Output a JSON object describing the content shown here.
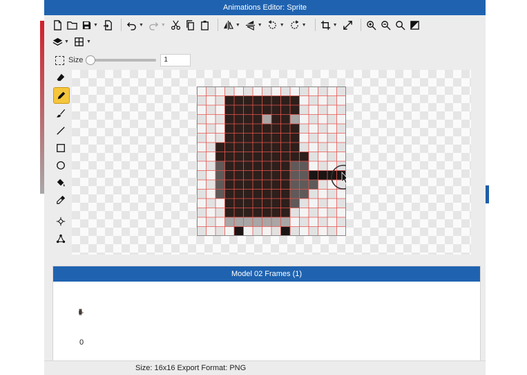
{
  "window": {
    "title": "Animations Editor: Sprite"
  },
  "toolbar": {
    "row1": [
      "new-file-icon",
      "open-folder-icon",
      "save-icon",
      "export-icon",
      "undo-icon",
      "redo-icon",
      "cut-icon",
      "copy-icon",
      "paste-icon",
      "flip-horizontal-icon",
      "flip-vertical-icon",
      "rotate-left-icon",
      "rotate-right-icon",
      "crop-icon",
      "resize-icon",
      "zoom-in-icon",
      "zoom-out-icon",
      "zoom-fit-icon",
      "invert-icon"
    ],
    "row2": [
      "layers-icon",
      "grid-icon"
    ]
  },
  "size_control": {
    "label": "Size",
    "value": "1",
    "slider_value_fraction": 0.0
  },
  "tools": [
    {
      "name": "select-tool",
      "icon": "marquee-icon",
      "active": false
    },
    {
      "name": "eraser-tool",
      "icon": "eraser-icon",
      "active": false
    },
    {
      "name": "pencil-tool",
      "icon": "pencil-icon",
      "active": true
    },
    {
      "name": "brush-tool",
      "icon": "brush-icon",
      "active": false
    },
    {
      "name": "line-tool",
      "icon": "line-icon",
      "active": false
    },
    {
      "name": "rectangle-tool",
      "icon": "rectangle-icon",
      "active": false
    },
    {
      "name": "ellipse-tool",
      "icon": "ellipse-icon",
      "active": false
    },
    {
      "name": "fill-tool",
      "icon": "paint-bucket-icon",
      "active": false
    },
    {
      "name": "eyedropper-tool",
      "icon": "eyedropper-icon",
      "active": false
    },
    {
      "name": "origin-tool",
      "icon": "crosshair-icon",
      "active": false
    },
    {
      "name": "bones-tool",
      "icon": "node-icon",
      "active": false
    }
  ],
  "sprite": {
    "width": 16,
    "height": 16,
    "colors": {
      "D": "#2d1f1b",
      "K": "#1a1514",
      "G": "#5f5a59",
      "L": "#a9a6a6"
    },
    "pixels": [
      "................",
      "...DDDDDDDD.....",
      "...DDDDDDDD.....",
      "...DDDDLDDL.....",
      "...DDDDDDDD.....",
      "...DDDDDDDD.....",
      "..DDDDDDDDD.....",
      "..DDDDDDDDDD....",
      "..GDDDDDDDGG....",
      "..GDDDDDDDGGKKKK",
      "..GDDDDDDDGGG...",
      "..GDDDDDDDGG....",
      "...DDDDDDDG.....",
      "...DDDDDDD......",
      "...LLLLLLL......",
      "....K....K......"
    ],
    "grid_color": "#e8554e"
  },
  "frames": {
    "header": "Model 02 Frames (1)",
    "items": [
      {
        "index": "0"
      }
    ]
  },
  "status": {
    "text": "Size: 16x16   Export Format: PNG"
  },
  "colors": {
    "accent": "#1f63b0",
    "active_tool": "#f5c53c"
  }
}
